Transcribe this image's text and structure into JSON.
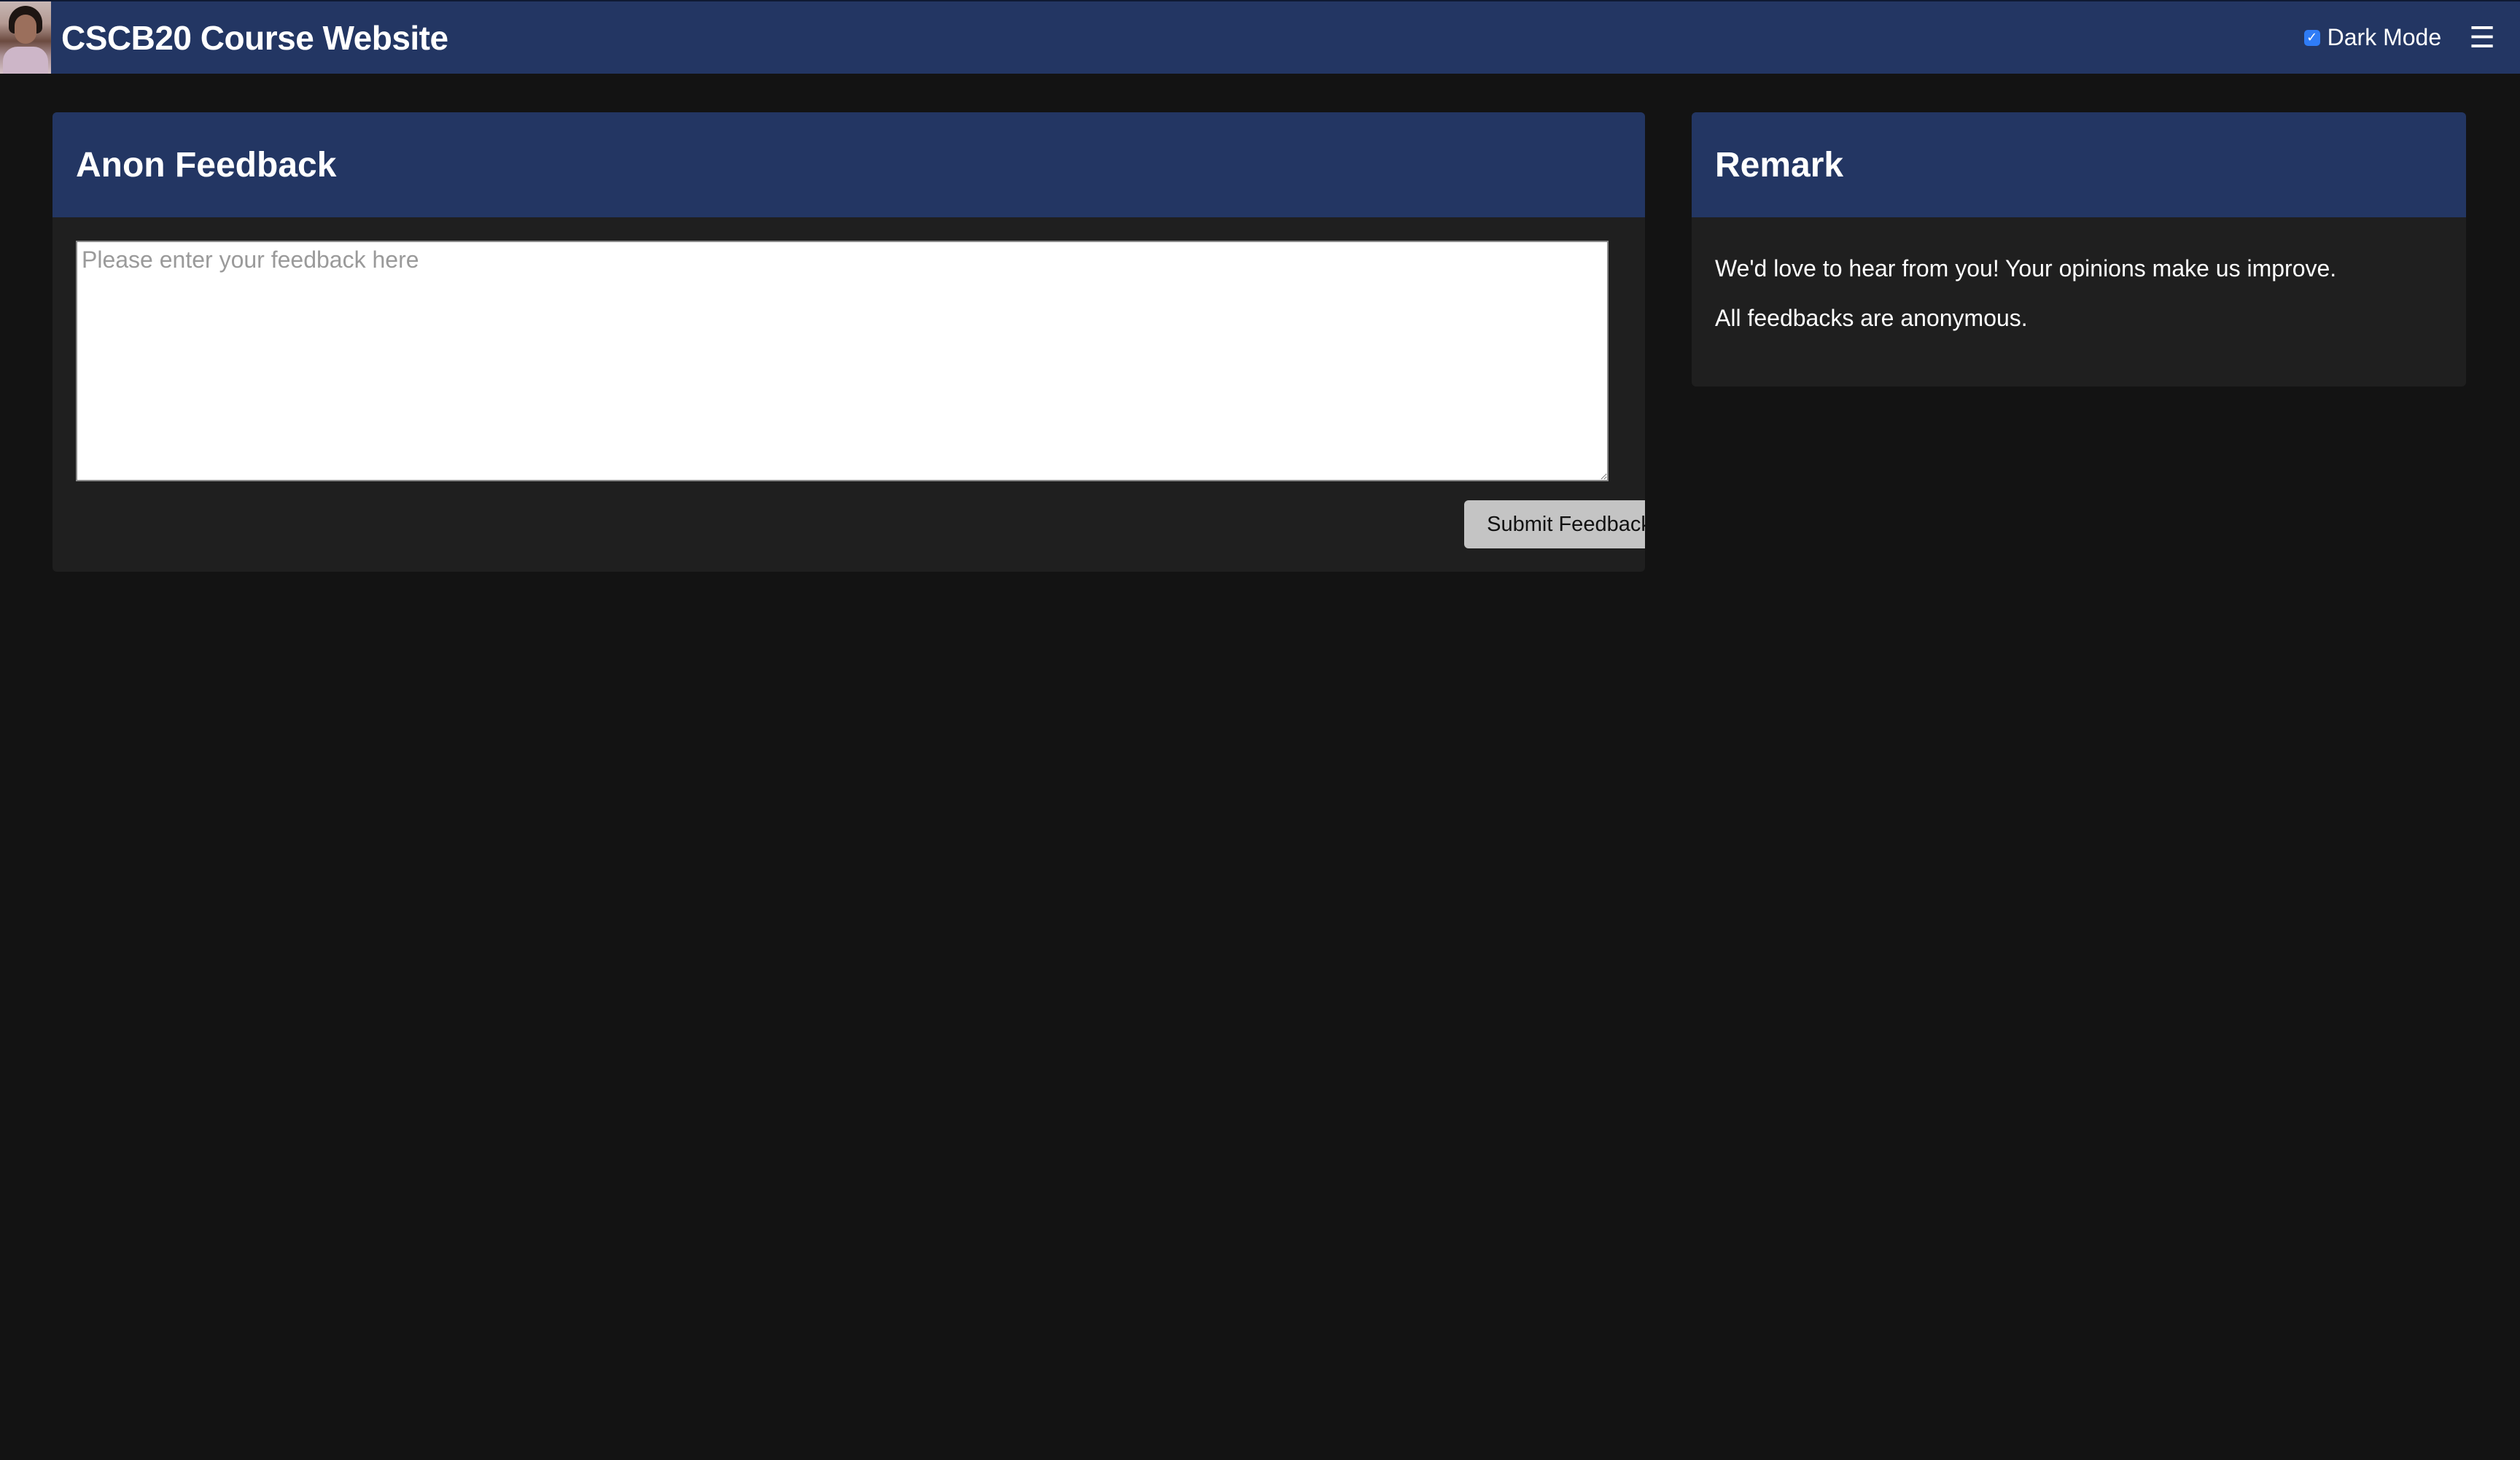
{
  "header": {
    "title": "CSCB20 Course Website",
    "dark_mode_label": "Dark Mode",
    "dark_mode_checked": true,
    "menu_icon": "hamburger-menu-icon"
  },
  "feedback": {
    "title": "Anon Feedback",
    "textarea_value": "",
    "textarea_placeholder": "Please enter your feedback here",
    "submit_label": "Submit Feedback"
  },
  "remark": {
    "title": "Remark",
    "lines": [
      "We'd love to hear from you! Your opinions make us improve.",
      "All feedbacks are anonymous."
    ]
  },
  "colors": {
    "background": "#131313",
    "header_bg": "#233663",
    "card_bg": "#1f1f1f",
    "button_bg": "#c4c4c4",
    "checkbox": "#2f7cf6"
  }
}
